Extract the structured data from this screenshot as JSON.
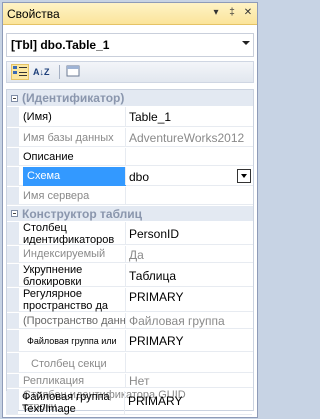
{
  "window": {
    "title": "Свойства",
    "controls": {
      "dropdown": "▾",
      "pin": "‡",
      "close": "✕"
    }
  },
  "object_selector": {
    "value": "[Tbl] dbo.Table_1"
  },
  "toolbar": {
    "buttons": [
      {
        "name": "categorized-icon",
        "active": true
      },
      {
        "name": "alphabetical-icon",
        "label": "A↓Z"
      },
      {
        "name": "property-pages-icon"
      }
    ]
  },
  "grid": {
    "cat_identity": "(Идентификатор)",
    "name_label": "(Имя)",
    "name_value": "Table_1",
    "db_label": "Имя базы данных",
    "db_value": "AdventureWorks2012",
    "desc_label": "Описание",
    "desc_value": "",
    "schema_label": "Схема",
    "schema_value": "dbo",
    "server_label": "Имя сервера",
    "server_value": "",
    "cat_designer": "Конструктор таблиц",
    "idcol_label": "Столбец идентификаторов",
    "idcol_value": "PersonID",
    "indexable_label": "Индексируемый",
    "indexable_value": "Да",
    "lock_label": "Укрупнение блокировки",
    "lock_value": "Таблица",
    "regular_label": "Регулярное пространство да",
    "regular_value": "PRIMARY",
    "space_label": "(Пространство данных)",
    "space_value": "Файловая группа",
    "fg_label": "Файловая группа или",
    "fg_value": "PRIMARY",
    "partcol_label": "Столбец секци",
    "partcol_value": "",
    "repl_label": "Репликация",
    "repl_value": "Нет",
    "guid_label": "Столбец идентификатора GUID строки",
    "guid_value": "",
    "textimg_label": "Файловая группа Text/Image",
    "textimg_value": "PRIMARY"
  }
}
